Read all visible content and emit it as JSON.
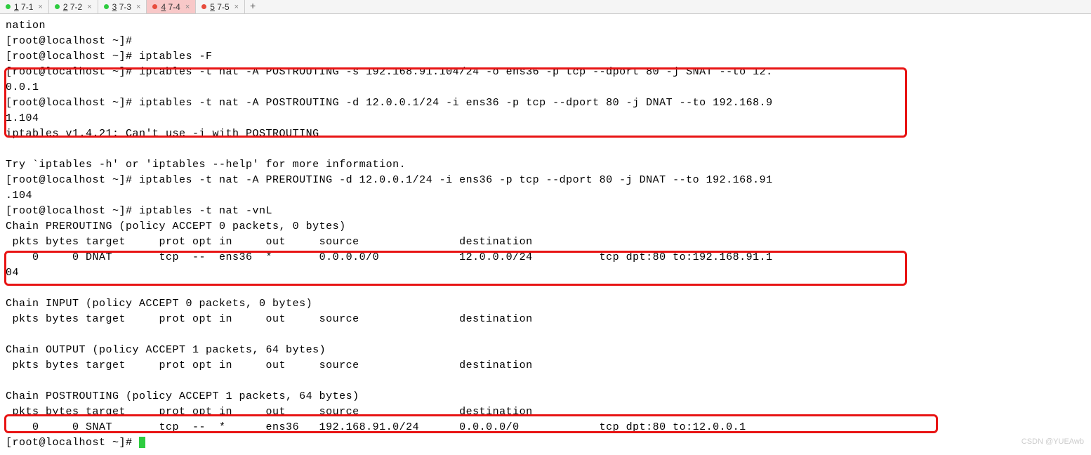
{
  "tabs": [
    {
      "num": "1",
      "label": "7-1",
      "color": "green",
      "active": false
    },
    {
      "num": "2",
      "label": "7-2",
      "color": "green",
      "active": false
    },
    {
      "num": "3",
      "label": "7-3",
      "color": "green",
      "active": false
    },
    {
      "num": "4",
      "label": "7-4",
      "color": "red",
      "active": true
    },
    {
      "num": "5",
      "label": "7-5",
      "color": "red",
      "active": false
    }
  ],
  "terminal": "nation\n[root@localhost ~]#\n[root@localhost ~]# iptables -F\n[root@localhost ~]# iptables -t nat -A POSTROUTING -s 192.168.91.104/24 -o ens36 -p tcp --dport 80 -j SNAT --to 12.\n0.0.1\n[root@localhost ~]# iptables -t nat -A POSTROUTING -d 12.0.0.1/24 -i ens36 -p tcp --dport 80 -j DNAT --to 192.168.9\n1.104\niptables v1.4.21: Can't use -i with POSTROUTING\n\nTry `iptables -h' or 'iptables --help' for more information.\n[root@localhost ~]# iptables -t nat -A PREROUTING -d 12.0.0.1/24 -i ens36 -p tcp --dport 80 -j DNAT --to 192.168.91\n.104\n[root@localhost ~]# iptables -t nat -vnL\nChain PREROUTING (policy ACCEPT 0 packets, 0 bytes)\n pkts bytes target     prot opt in     out     source               destination\n    0     0 DNAT       tcp  --  ens36  *       0.0.0.0/0            12.0.0.0/24          tcp dpt:80 to:192.168.91.1\n04\n\nChain INPUT (policy ACCEPT 0 packets, 0 bytes)\n pkts bytes target     prot opt in     out     source               destination\n\nChain OUTPUT (policy ACCEPT 1 packets, 64 bytes)\n pkts bytes target     prot opt in     out     source               destination\n\nChain POSTROUTING (policy ACCEPT 1 packets, 64 bytes)\n pkts bytes target     prot opt in     out     source               destination\n    0     0 SNAT       tcp  --  *      ens36   192.168.91.0/24      0.0.0.0/0            tcp dpt:80 to:12.0.0.1\n[root@localhost ~]# ",
  "watermark": "CSDN @YUEAwb"
}
